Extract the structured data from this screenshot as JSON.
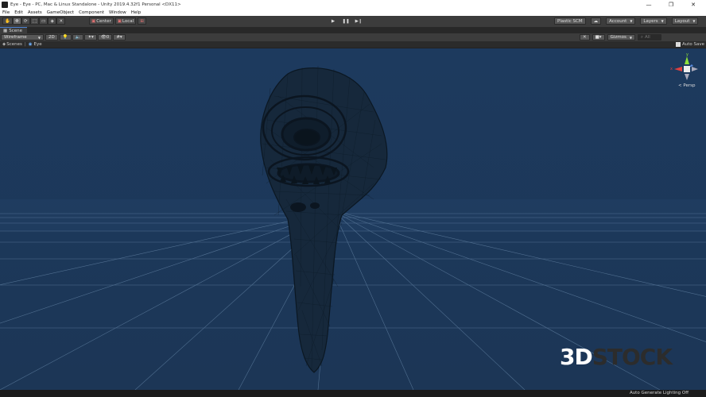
{
  "window": {
    "title": "Eye - Eye - PC, Mac & Linux Standalone - Unity 2019.4.32f1 Personal <DX11>",
    "controls": {
      "minimize": "—",
      "maximize": "❐",
      "close": "✕"
    }
  },
  "menu": [
    "File",
    "Edit",
    "Assets",
    "GameObject",
    "Component",
    "Window",
    "Help"
  ],
  "toolbar": {
    "tools": [
      "hand-tool",
      "move-tool",
      "rotate-tool",
      "scale-tool",
      "rect-tool",
      "transform-tool",
      "custom-tool"
    ],
    "center_label": "Center",
    "local_label": "Local",
    "collab_label": "Plastic SCM",
    "account_label": "Account",
    "layers_label": "Layers",
    "layout_label": "Layout"
  },
  "tabs": {
    "scene": "Scene"
  },
  "scene_toolbar": {
    "draw_mode": "Wireframe",
    "mode_2d": "2D",
    "gizmos_label": "Gizmos",
    "search_placeholder": "All"
  },
  "breadcrumb": {
    "root": "Scenes",
    "current": "Eye"
  },
  "autosave_label": "Auto Save",
  "gizmo": {
    "projection": "< Persp",
    "y": "y",
    "x": "x"
  },
  "status": "Auto Generate Lighting Off",
  "watermark": {
    "part1": "3D",
    "part2": "STOCK"
  },
  "colors": {
    "viewport_bg": "#1e3a5c",
    "grid": "#5d7d9e",
    "mesh": "#0d1b28",
    "accent": "#4a80d0"
  }
}
